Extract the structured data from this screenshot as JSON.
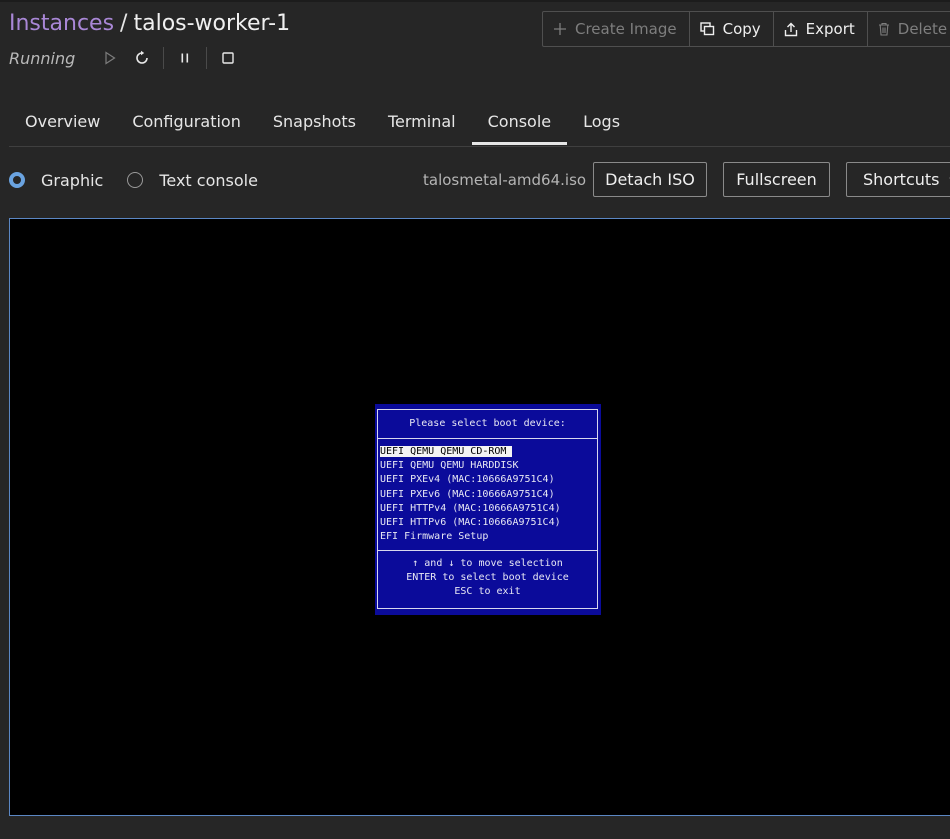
{
  "breadcrumb": {
    "parent": "Instances",
    "separator": "/",
    "current": "talos-worker-1"
  },
  "status": {
    "text": "Running"
  },
  "controls": {
    "start_icon": "play-icon",
    "restart_icon": "restart-icon",
    "pause_icon": "pause-icon",
    "stop_icon": "stop-icon"
  },
  "actions": {
    "create_image": "Create Image",
    "copy": "Copy",
    "export": "Export",
    "delete": "Delete"
  },
  "tabs": [
    {
      "label": "Overview",
      "active": false
    },
    {
      "label": "Configuration",
      "active": false
    },
    {
      "label": "Snapshots",
      "active": false
    },
    {
      "label": "Terminal",
      "active": false
    },
    {
      "label": "Console",
      "active": true
    },
    {
      "label": "Logs",
      "active": false
    }
  ],
  "console": {
    "mode_graphic": "Graphic",
    "mode_text": "Text console",
    "selected_mode": "Graphic",
    "iso_name": "talosmetal-amd64.iso",
    "detach_iso": "Detach ISO",
    "fullscreen": "Fullscreen",
    "shortcuts": "Shortcuts"
  },
  "boot_menu": {
    "title": "Please select boot device:",
    "items": [
      "UEFI QEMU QEMU CD-ROM",
      "UEFI QEMU QEMU HARDDISK",
      "UEFI PXEv4 (MAC:10666A9751C4)",
      "UEFI PXEv6 (MAC:10666A9751C4)",
      "UEFI HTTPv4 (MAC:10666A9751C4)",
      "UEFI HTTPv6 (MAC:10666A9751C4)",
      "EFI Firmware Setup"
    ],
    "selected_index": 0,
    "help": [
      "↑ and ↓ to move selection",
      "ENTER to select boot device",
      "ESC to exit"
    ]
  },
  "colors": {
    "accent_link": "#a987d6",
    "radio_checked": "#6aa3e0",
    "console_border": "#5b87c4",
    "bios_background": "#0b0b9a"
  }
}
